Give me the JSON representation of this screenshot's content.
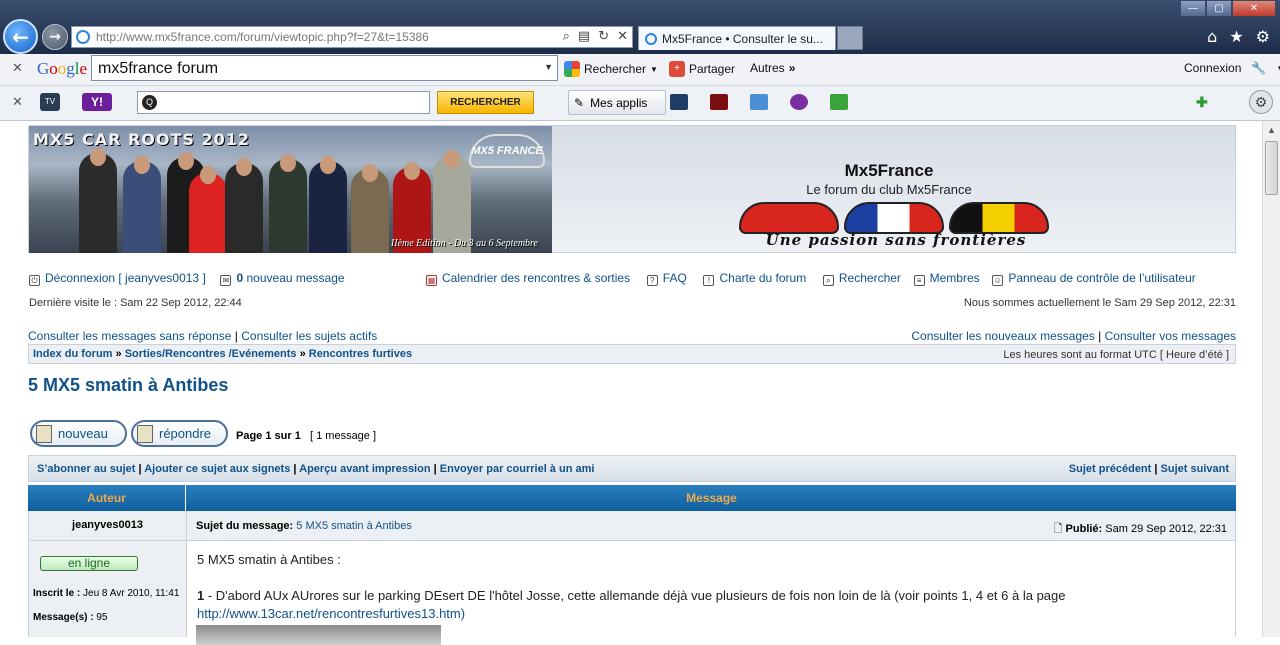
{
  "browser": {
    "url": "http://www.mx5france.com/forum/viewtopic.php?f=27&t=15386",
    "tab_title": "Mx5France • Consulter le su...",
    "google_query": "mx5france forum",
    "google_logo": "Google",
    "g_rechercher": "Rechercher",
    "g_partager": "Partager",
    "g_autres": "Autres",
    "g_connexion": "Connexion",
    "yahoo_logo": "Y!",
    "yahoo_button": "RECHERCHER",
    "mes_applis": "Mes applis",
    "colors": {
      "toolbar_bg": "#f0f2f5",
      "nav_bg": "#1d2c47",
      "yahoo": "#6b1f9a"
    }
  },
  "forum": {
    "banner_title": "MX5 CAR ROOTS 2012",
    "banner_subtitle": "IIème Edition - Du 3 au 6 Septembre",
    "banner_logo": "MX5 FRANCE",
    "site_title": "Mx5France",
    "site_desc": "Le forum du club Mx5France",
    "slogan": "Une passion sans frontières",
    "logout": "Déconnexion [ jeanyves0013 ]",
    "new_messages_count": "0",
    "new_messages_label": "nouveau message",
    "nav_links": [
      "Calendrier des rencontres & sorties",
      "FAQ",
      "Charte du forum",
      "Rechercher",
      "Membres",
      "Panneau de contrôle de l’utilisateur"
    ],
    "last_visit": "Dernière visite le : Sam 22 Sep 2012, 22:44",
    "now": "Nous sommes actuellement le Sam 29 Sep 2012, 22:31",
    "unanswered": "Consulter les messages sans réponse",
    "active": "Consulter les sujets actifs",
    "new_posts": "Consulter les nouveaux messages",
    "your_posts": "Consulter vos messages",
    "breadcrumb": [
      "Index du forum",
      "Sorties/Rencontres /Evénements",
      "Rencontres furtives"
    ],
    "timezone": "Les heures sont au format UTC [ Heure d’été ]",
    "topic_title": "5 MX5 smatin à Antibes",
    "btn_new": "nouveau",
    "btn_reply": "répondre",
    "page_label": "Page 1 sur 1",
    "message_count": "[ 1 message ]",
    "actions_left": [
      "S’abonner au sujet",
      "Ajouter ce sujet aux signets",
      "Aperçu avant impression",
      "Envoyer par courriel à un ami"
    ],
    "actions_right": [
      "Sujet précédent",
      "Sujet suivant"
    ],
    "table_header": {
      "author": "Auteur",
      "message": "Message"
    },
    "colors": {
      "link": "#105289",
      "table_header": "#0f5f9d",
      "header_text": "#f0a94a"
    }
  },
  "post": {
    "author": "jeanyves0013",
    "subject_label": "Sujet du message:",
    "subject": "5 MX5 smatin à Antibes",
    "posted_label": "Publié:",
    "posted": "Sam 29 Sep 2012, 22:31",
    "status": "en ligne",
    "joined_label": "Inscrit le :",
    "joined": "Jeu 8 Avr 2010, 11:41",
    "posts_label": "Message(s) :",
    "posts": "95",
    "intro": "5 MX5 smatin à Antibes :",
    "p1_num": "1",
    "p1_text": " - D'abord AUx AUrores sur le parking DEsert DE l'hôtel Josse, cette allemande déjà vue plusieurs de fois non loin de là (voir points 1, 4 et 6 à la page",
    "p1_link": "http://www.13car.net/rencontresfurtives13.htm)"
  }
}
